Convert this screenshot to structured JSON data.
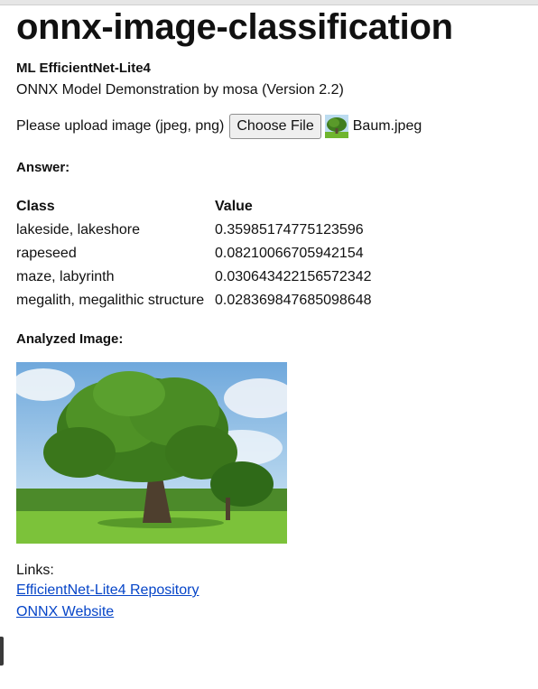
{
  "page": {
    "title": "onnx-image-classification",
    "subtitle": "ML EfficientNet-Lite4",
    "description": "ONNX Model Demonstration by mosa (Version 2.2)"
  },
  "upload": {
    "label": "Please upload image (jpeg, png)",
    "button_label": "Choose File",
    "file_name": "Baum.jpeg",
    "thumbnail_icon": "tree-thumbnail-icon"
  },
  "answer": {
    "heading": "Answer:",
    "columns": [
      "Class",
      "Value"
    ],
    "rows": [
      {
        "class": "lakeside, lakeshore",
        "value": "0.35985174775123596"
      },
      {
        "class": "rapeseed",
        "value": "0.08210066705942154"
      },
      {
        "class": "maze, labyrinth",
        "value": "0.030643422156572342"
      },
      {
        "class": "megalith, megalithic structure",
        "value": "0.028369847685098648"
      }
    ]
  },
  "analyzed": {
    "heading": "Analyzed Image:"
  },
  "links": {
    "heading": "Links:",
    "items": [
      {
        "label": "EfficientNet-Lite4 Repository"
      },
      {
        "label": "ONNX Website"
      }
    ]
  },
  "colors": {
    "link": "#0645c8",
    "sky": "#8fc3ea",
    "grass": "#6fb52e",
    "foliage": "#3f7d1e"
  }
}
